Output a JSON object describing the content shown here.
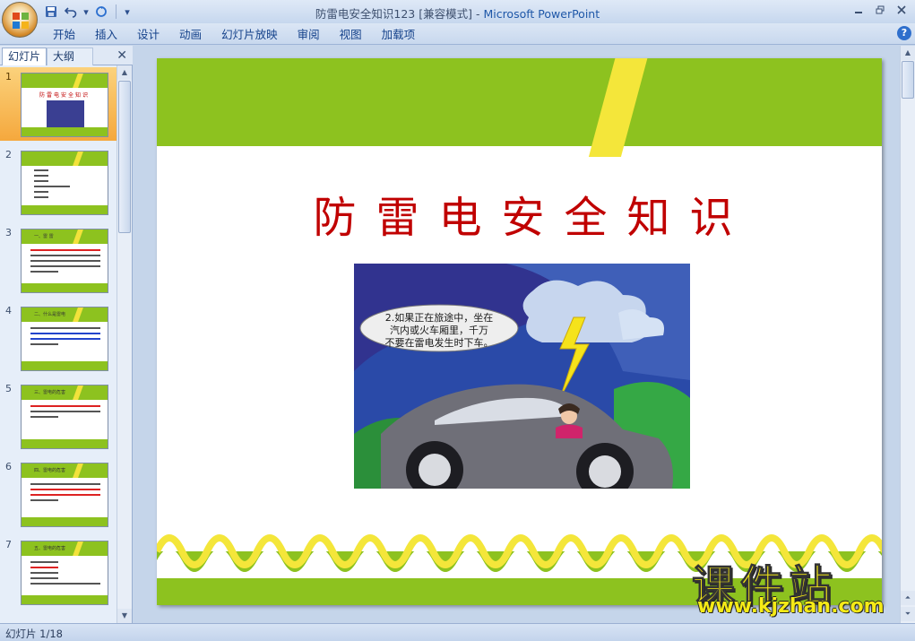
{
  "window": {
    "title_doc": "防雷电安全知识123 [兼容模式]",
    "title_app": "Microsoft PowerPoint"
  },
  "ribbon": {
    "tabs": [
      "开始",
      "插入",
      "设计",
      "动画",
      "幻灯片放映",
      "审阅",
      "视图",
      "加载项"
    ]
  },
  "left_pane": {
    "tab_slides": "幻灯片",
    "tab_outline": "大纲"
  },
  "thumbnails": [
    {
      "num": "1",
      "head": "防雷电安全知识"
    },
    {
      "num": "2",
      "head": ""
    },
    {
      "num": "3",
      "head": "一、雷 雷"
    },
    {
      "num": "4",
      "head": "二、什么是雷电"
    },
    {
      "num": "5",
      "head": "三、雷电的危害"
    },
    {
      "num": "6",
      "head": "四、雷电的危害"
    },
    {
      "num": "7",
      "head": "五、雷电的危害"
    }
  ],
  "slide": {
    "title": "防雷电安全知识",
    "bubble_text": [
      "2.如果正在旅途中，坐在",
      "汽内或火车厢里，千万",
      "不要在雷电发生时下车。"
    ]
  },
  "watermark": {
    "cn": "课件站",
    "en": "www.kjzhan.com"
  },
  "status": {
    "slide_indicator": "幻灯片 1/18"
  },
  "colors": {
    "slide_green": "#8dc21f",
    "slide_yellow": "#f4e63a",
    "title_red": "#c00000"
  }
}
